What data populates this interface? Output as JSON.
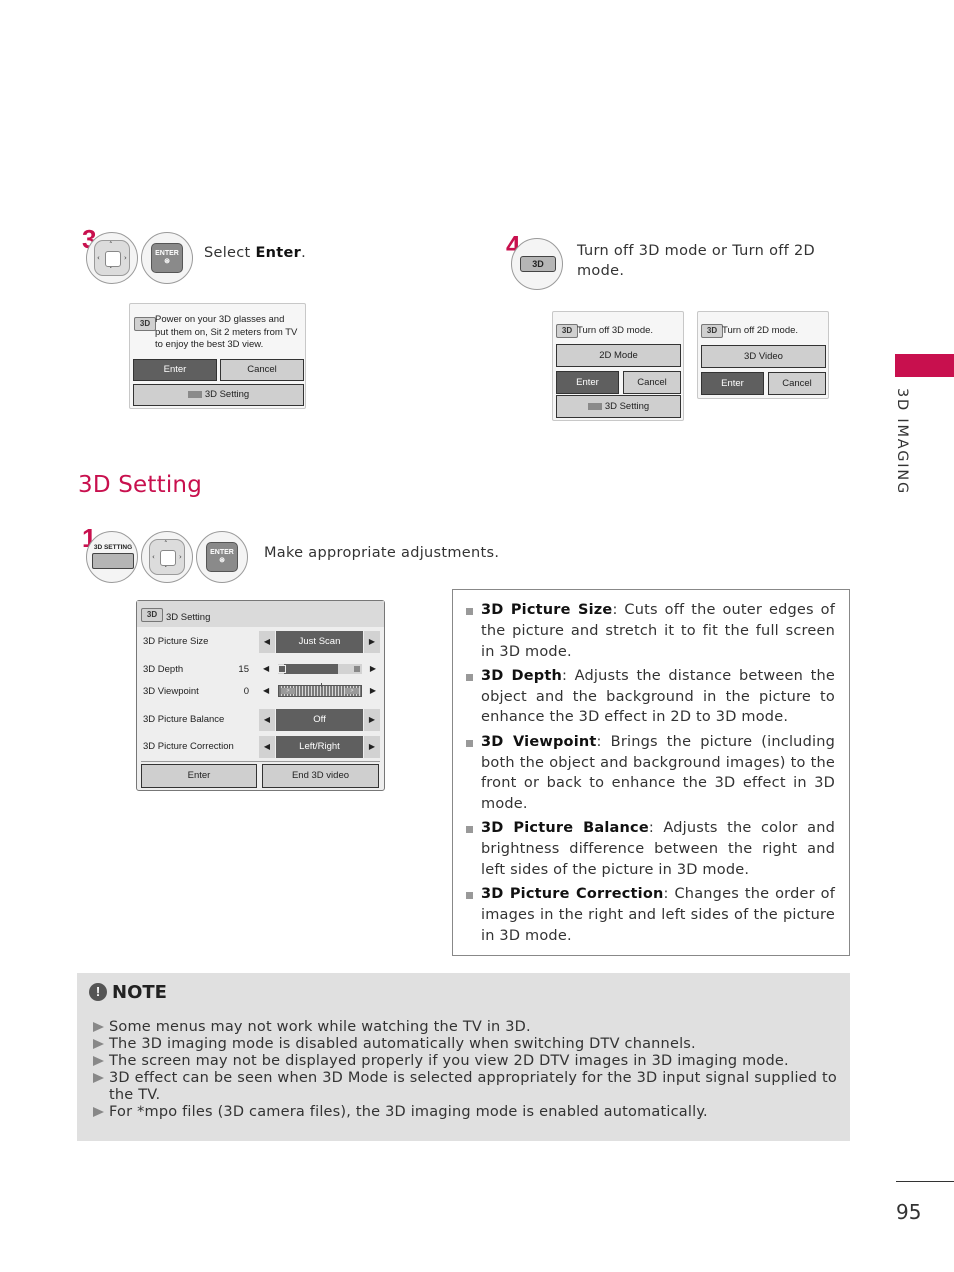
{
  "side_tab": {
    "label": "3D IMAGING",
    "accent": "#c8104e"
  },
  "page_number": "95",
  "step3": {
    "number": "3",
    "remote_keys": [
      "dpad-icon",
      "enter-key"
    ],
    "enter_key_label": "ENTER",
    "enter_key_symbol": "⊛",
    "instruction_prefix": "Select ",
    "instruction_bold": "Enter",
    "instruction_suffix": ".",
    "osd": {
      "message": "Power on your 3D glasses and put them on, Sit 2 meters from TV to enjoy the best 3D view.",
      "enter_label": "Enter",
      "cancel_label": "Cancel",
      "setting_label": "3D Setting"
    }
  },
  "step4": {
    "number": "4",
    "key_label": "3D",
    "instruction": "Turn off 3D mode or Turn off 2D mode.",
    "osd_3d_off": {
      "message": "Turn off 3D mode.",
      "mode_label": "2D Mode",
      "enter_label": "Enter",
      "cancel_label": "Cancel",
      "setting_label": "3D Setting"
    },
    "osd_2d_off": {
      "message": "Turn off 2D mode.",
      "mode_label": "3D Video",
      "enter_label": "Enter",
      "cancel_label": "Cancel"
    }
  },
  "section_title": "3D Setting",
  "step1": {
    "number": "1",
    "setting_key_label": "3D SETTING",
    "enter_key_label": "ENTER",
    "enter_key_symbol": "⊛",
    "instruction": "Make appropriate adjustments."
  },
  "menu": {
    "logo": "3D",
    "title": "3D Setting",
    "rows": [
      {
        "label": "3D Picture Size",
        "value": "Just Scan"
      },
      {
        "label": "3D Depth",
        "number": "15",
        "slider_fraction": 0.72
      },
      {
        "label": "3D Viewpoint",
        "number": "0",
        "slider_fraction": 0.5
      },
      {
        "label": "3D Picture Balance",
        "value": "Off"
      },
      {
        "label": "3D Picture Correction",
        "value": "Left/Right"
      }
    ],
    "enter_label": "Enter",
    "end_label": "End 3D video"
  },
  "descriptions": [
    {
      "term": "3D Picture Size",
      "text": ": Cuts off the outer edges of the picture and stretch it to fit the full screen in 3D mode."
    },
    {
      "term": "3D Depth",
      "text": ": Adjusts the distance between the object and the background in the picture to enhance the 3D effect in 2D to 3D mode."
    },
    {
      "term": "3D Viewpoint",
      "text": ": Brings the picture (including both the object and background images) to the front or back to enhance the 3D effect in 3D mode."
    },
    {
      "term": "3D Picture Balance",
      "text": ": Adjusts the color and brightness difference between the right and left sides of the picture in 3D mode."
    },
    {
      "term": "3D Picture Correction",
      "text": ": Changes the order of images in the right and left sides of the picture in 3D mode."
    }
  ],
  "note": {
    "icon": "!",
    "title": "NOTE",
    "items": [
      "Some menus may not work while watching the TV in 3D.",
      "The 3D imaging mode is disabled automatically when switching DTV channels.",
      "The screen may not be displayed properly if you view 2D DTV images in 3D imaging mode.",
      "3D effect can be seen when 3D Mode is selected appropriately for the 3D input signal supplied to the TV.",
      "For *mpo files (3D camera files), the 3D imaging mode is enabled automatically."
    ]
  }
}
